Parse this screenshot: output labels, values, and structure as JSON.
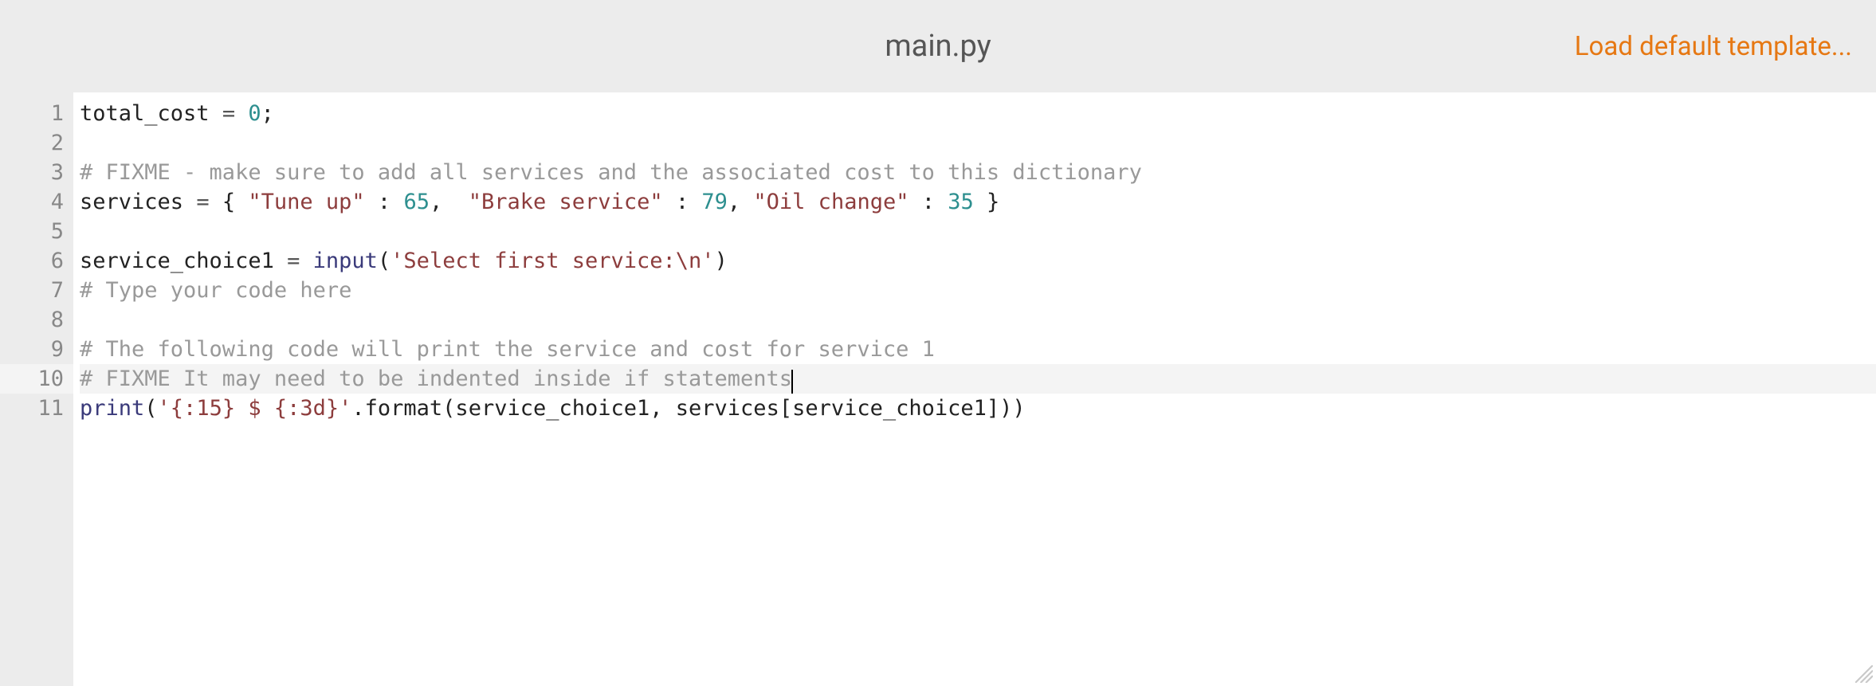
{
  "header": {
    "title": "main.py",
    "load_link": "Load default template..."
  },
  "editor": {
    "line_numbers": [
      "1",
      "2",
      "3",
      "4",
      "5",
      "6",
      "7",
      "8",
      "9",
      "10",
      "11"
    ],
    "highlighted_line_index": 9,
    "cursor_line_index": 9,
    "code_lines": [
      {
        "segments": [
          {
            "t": "total_cost ",
            "c": ""
          },
          {
            "t": "=",
            "c": "c-op"
          },
          {
            "t": " ",
            "c": ""
          },
          {
            "t": "0",
            "c": "c-num"
          },
          {
            "t": ";",
            "c": ""
          }
        ]
      },
      {
        "segments": []
      },
      {
        "segments": [
          {
            "t": "# FIXME - make sure to add all services and the associated cost to this dictionary",
            "c": "c-comment"
          }
        ]
      },
      {
        "segments": [
          {
            "t": "services ",
            "c": ""
          },
          {
            "t": "=",
            "c": "c-op"
          },
          {
            "t": " { ",
            "c": ""
          },
          {
            "t": "\"Tune up\"",
            "c": "c-str"
          },
          {
            "t": " : ",
            "c": ""
          },
          {
            "t": "65",
            "c": "c-num"
          },
          {
            "t": ",  ",
            "c": ""
          },
          {
            "t": "\"Brake service\"",
            "c": "c-str"
          },
          {
            "t": " : ",
            "c": ""
          },
          {
            "t": "79",
            "c": "c-num"
          },
          {
            "t": ", ",
            "c": ""
          },
          {
            "t": "\"Oil change\"",
            "c": "c-str"
          },
          {
            "t": " : ",
            "c": ""
          },
          {
            "t": "35",
            "c": "c-num"
          },
          {
            "t": " }",
            "c": ""
          }
        ]
      },
      {
        "segments": []
      },
      {
        "segments": [
          {
            "t": "service_choice1 ",
            "c": ""
          },
          {
            "t": "=",
            "c": "c-op"
          },
          {
            "t": " ",
            "c": ""
          },
          {
            "t": "input",
            "c": "c-func"
          },
          {
            "t": "(",
            "c": ""
          },
          {
            "t": "'Select first service:\\n'",
            "c": "c-str"
          },
          {
            "t": ")",
            "c": ""
          }
        ]
      },
      {
        "segments": [
          {
            "t": "# Type your code here",
            "c": "c-comment"
          }
        ]
      },
      {
        "segments": []
      },
      {
        "segments": [
          {
            "t": "# The following code will print the service and cost for service 1",
            "c": "c-comment"
          }
        ]
      },
      {
        "segments": [
          {
            "t": "# FIXME It may need to be indented inside if statements",
            "c": "c-comment"
          }
        ]
      },
      {
        "segments": [
          {
            "t": "print",
            "c": "c-func"
          },
          {
            "t": "(",
            "c": ""
          },
          {
            "t": "'{:15} $ {:3d}'",
            "c": "c-str"
          },
          {
            "t": ".format(service_choice1, services[service_choice1]))",
            "c": ""
          }
        ]
      }
    ]
  }
}
